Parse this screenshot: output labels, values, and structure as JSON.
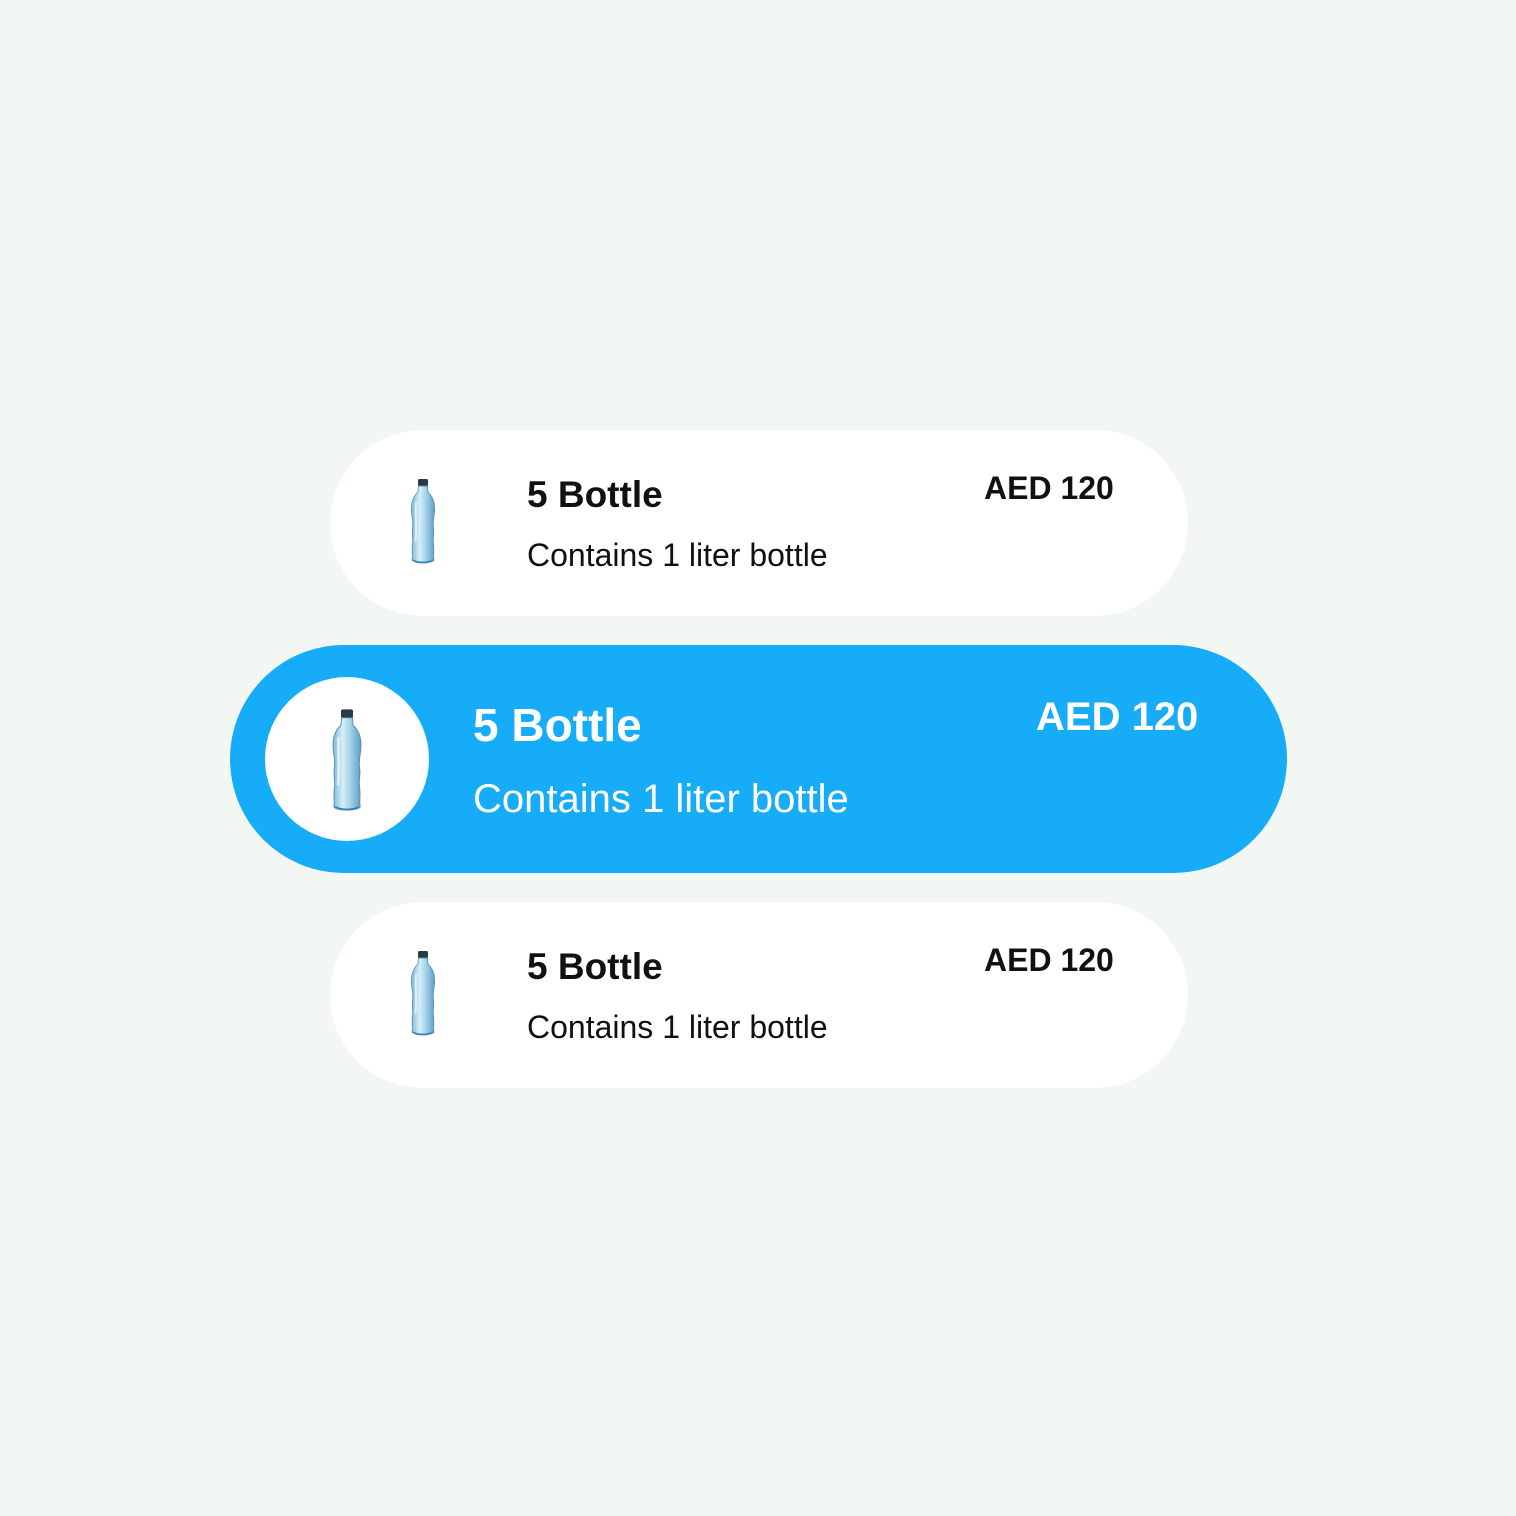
{
  "colors": {
    "background": "#f2f7f4",
    "card": "#ffffff",
    "selected_card": "#17acf8",
    "text_dark": "#111111",
    "text_light": "#ffffff"
  },
  "options": [
    {
      "title": "5 Bottle",
      "subtitle": "Contains 1 liter bottle",
      "price": "AED 120",
      "icon": "water-bottle-icon",
      "selected": false
    },
    {
      "title": "5 Bottle",
      "subtitle": "Contains 1 liter bottle",
      "price": "AED 120",
      "icon": "water-bottle-icon",
      "selected": true
    },
    {
      "title": "5 Bottle",
      "subtitle": "Contains 1 liter bottle",
      "price": "AED 120",
      "icon": "water-bottle-icon",
      "selected": false
    }
  ]
}
